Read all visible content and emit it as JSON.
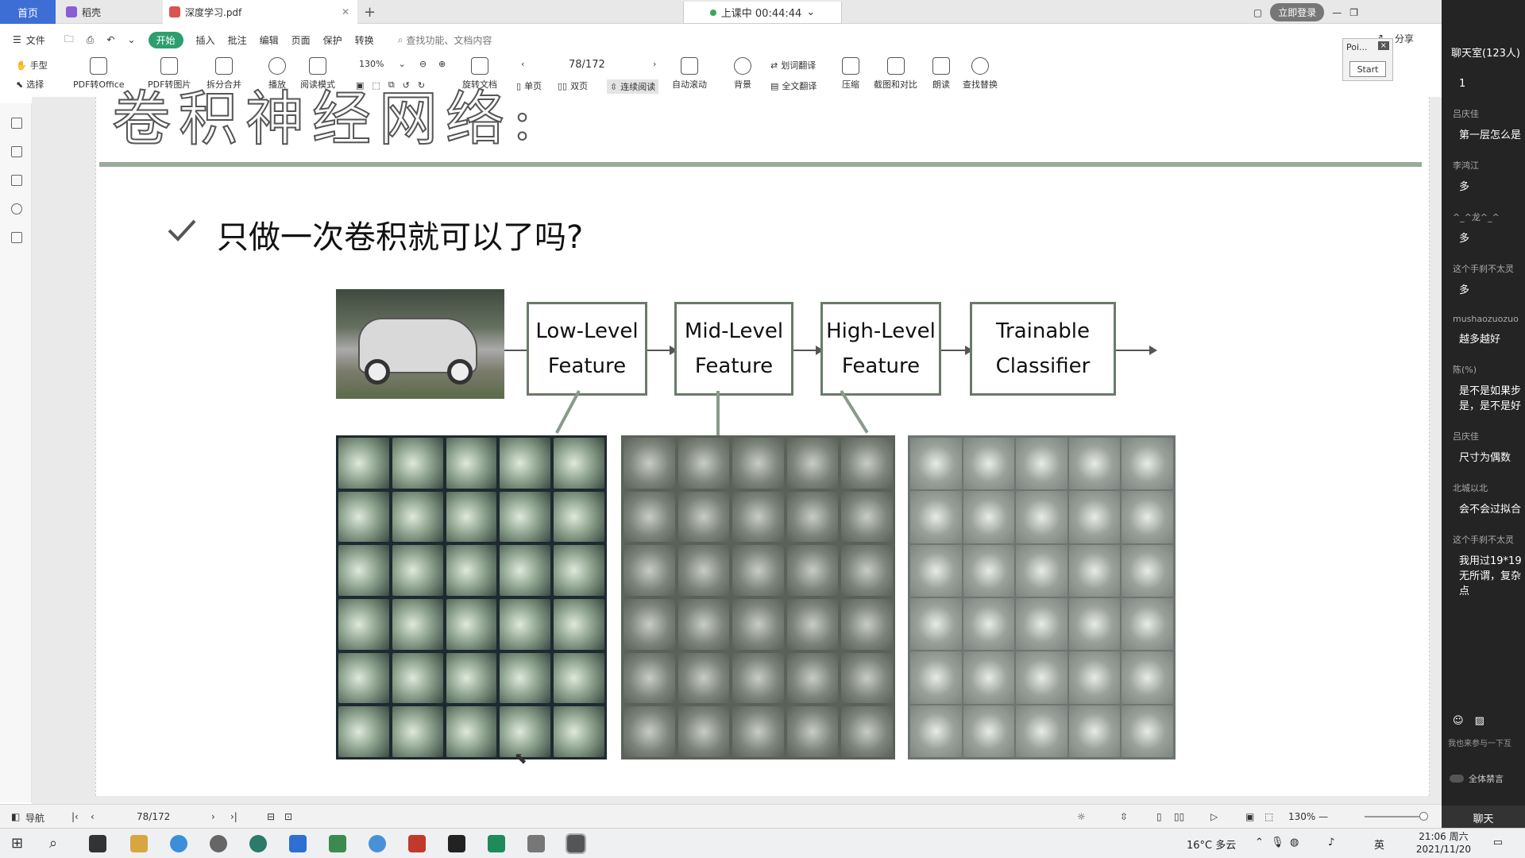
{
  "tabs": {
    "home": "首页",
    "docer": "稻壳",
    "pdf": "深度学习.pdf",
    "add": "+"
  },
  "timer": "上课中 00:44:44",
  "login": "立即登录",
  "menu": {
    "file": "文件",
    "items": [
      "开始",
      "插入",
      "批注",
      "编辑",
      "页面",
      "保护",
      "转换"
    ],
    "search": "查找功能、文档内容",
    "right": [
      "分享"
    ]
  },
  "toolbar": {
    "hand": "手型",
    "select": "选择",
    "pdf_to_office": "PDF转Office",
    "pdf_to_image": "PDF转图片",
    "split_merge": "拆分合并",
    "play": "播放",
    "read_mode": "阅读模式",
    "zoom": "130%",
    "rotate": "旋转文档",
    "page": "78/172",
    "single": "单页",
    "double": "双页",
    "continuous": "连续阅读",
    "auto_scroll": "自动滚动",
    "background": "背景",
    "word_translate": "划词翻译",
    "full_translate": "全文翻译",
    "compress": "压缩",
    "screenshot_compare": "截图和对比",
    "read_aloud": "朗读",
    "find_replace": "查找替换"
  },
  "poi": {
    "title": "Poi...",
    "start": "Start"
  },
  "slide": {
    "title": "卷积神经网络:",
    "question": "只做一次卷积就可以了吗?",
    "boxes": [
      {
        "line1": "Low-Level",
        "line2": "Feature"
      },
      {
        "line1": "Mid-Level",
        "line2": "Feature"
      },
      {
        "line1": "High-Level",
        "line2": "Feature"
      },
      {
        "line1": "Trainable",
        "line2": "Classifier"
      }
    ]
  },
  "chat": {
    "header": "聊天室(123人)",
    "messages": [
      {
        "name": "",
        "text": "1"
      },
      {
        "name": "吕庆佳",
        "text": "第一层怎么是"
      },
      {
        "name": "李鸿江",
        "text": "多"
      },
      {
        "name": "^_^龙^_^",
        "text": "多"
      },
      {
        "name": "这个手刹不太灵",
        "text": "多"
      },
      {
        "name": "mushaozuozuo",
        "text": "越多越好"
      },
      {
        "name": "陈(%)",
        "text": "是不是如果步\n是，是不是好"
      },
      {
        "name": "吕庆佳",
        "text": "尺寸为偶数"
      },
      {
        "name": "北城以北",
        "text": "会不会过拟合"
      },
      {
        "name": "这个手刹不太灵",
        "text": "我用过19*19\n无所谓，复杂\n点"
      }
    ],
    "participate": "我也来参与一下互",
    "mute_all": "全体禁言",
    "tab": "聊天"
  },
  "statusbar": {
    "nav": "导航",
    "page": "78/172",
    "zoom": "130%"
  },
  "taskbar": {
    "weather": "16°C 多云",
    "ime": "英",
    "time": "21:06 周六",
    "date": "2021/11/20"
  }
}
